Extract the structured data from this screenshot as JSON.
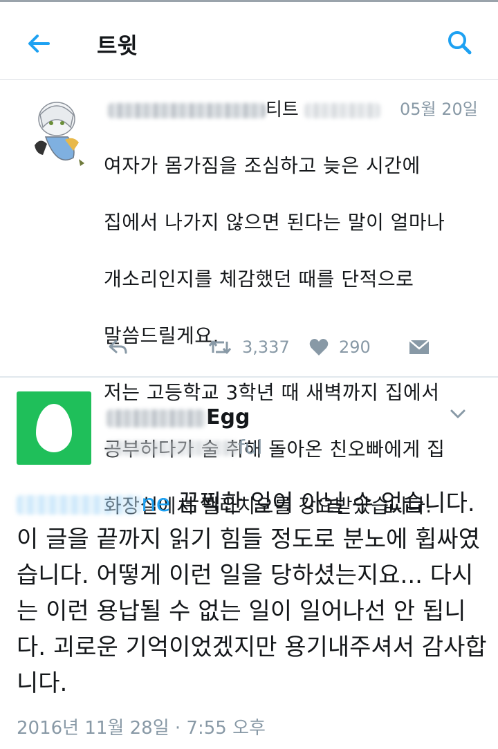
{
  "header": {
    "title": "트윗"
  },
  "tweet1": {
    "name_visible": "티트",
    "date": "05월 20일",
    "text_lines": [
      "여자가 몸가짐을 조심하고 늦은 시간에",
      "집에서 나가지 않으면 된다는 말이 얼마나",
      "개소리인지를 체감했던 때를 단적으로",
      "말씀드릴게요.",
      "저는 고등학교 3학년 때 새벽까지 집에서",
      "공부하다가 술 취해 돌아온 친오빠에게 집",
      "화장실에서 펠라치오를 강요받았습니다."
    ],
    "retweets": "3,337",
    "likes": "290"
  },
  "tweet2": {
    "name_visible": "Egg",
    "handle_visible": "ful",
    "mention_visible": "ne",
    "text": "끔찍한 일이 아닐 수 없습니다. 이 글을 끝까지 읽기 힘들 정도로 분노에 휩싸였습니다. 어떻게 이런 일을 당하셨는지요... 다시는 이런 용납될 수 없는 일이 일어나선 안 됩니다. 괴로운 기억이었겠지만 용기내주셔서 감사합니다.",
    "timestamp": "2016년 11월 28일 · 7:55 오후"
  },
  "colors": {
    "accent": "#1da1f2",
    "egg_bg": "#1fbf5a",
    "muted": "#8899a6"
  }
}
